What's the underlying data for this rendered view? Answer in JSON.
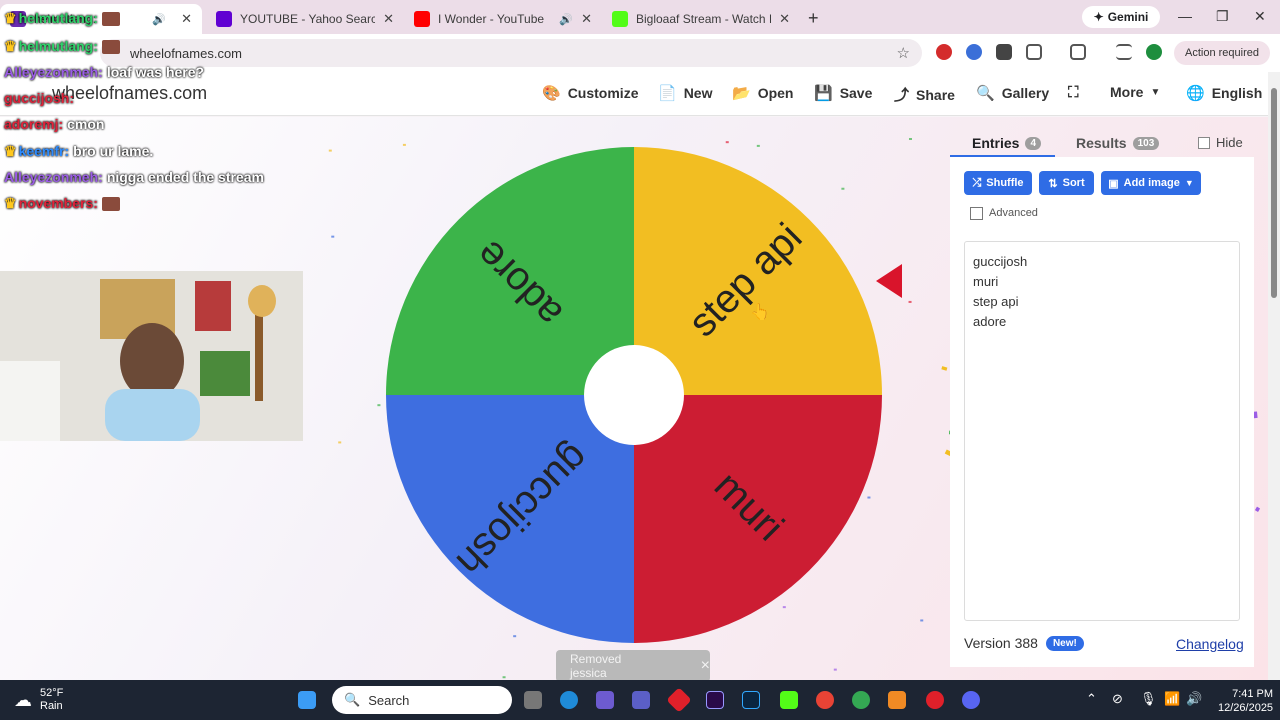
{
  "browser": {
    "tabs": [
      {
        "title": "helmutlang:",
        "favicon_color": "#6a2cb0",
        "audio": true
      },
      {
        "title": "YOUTUBE - Yahoo Search Results",
        "favicon_color": "#6001d2",
        "audio": false
      },
      {
        "title": "I Wonder - YouTube",
        "favicon_color": "#ff0000",
        "audio": true
      },
      {
        "title": "Bigloaaf Stream - Watch Live on",
        "favicon_color": "#53fc18",
        "audio": false
      }
    ],
    "new_tab_symbol": "+",
    "gemini_label": "Gemini",
    "url": "wheelofnames.com",
    "action_required": "Action required"
  },
  "site": {
    "logo_text": "wheelofnames.com",
    "nav": [
      {
        "label": "Customize",
        "icon": "palette-icon"
      },
      {
        "label": "New",
        "icon": "file-icon"
      },
      {
        "label": "Open",
        "icon": "folder-icon"
      },
      {
        "label": "Save",
        "icon": "save-icon"
      },
      {
        "label": "Share",
        "icon": "share-icon"
      },
      {
        "label": "Gallery",
        "icon": "search-icon"
      },
      {
        "label": "",
        "icon": "fullscreen-icon"
      },
      {
        "label": "More",
        "icon": "chevron-down-icon"
      },
      {
        "label": "English",
        "icon": "globe-icon"
      }
    ]
  },
  "wheel": {
    "segments": [
      {
        "label": "step api",
        "color": "#f2be22"
      },
      {
        "label": "muri",
        "color": "#cc1d33"
      },
      {
        "label": "guccijosh",
        "color": "#3e6ee0"
      },
      {
        "label": "adore",
        "color": "#3cb44a"
      }
    ],
    "pointer_color": "#d9142b"
  },
  "panel": {
    "tabs": [
      {
        "label": "Entries",
        "count": "4"
      },
      {
        "label": "Results",
        "count": "103"
      }
    ],
    "hide_label": "Hide",
    "buttons": {
      "shuffle": "Shuffle",
      "sort": "Sort",
      "add_image": "Add image"
    },
    "advanced_label": "Advanced",
    "entries": [
      "guccijosh",
      "muri",
      "step api",
      "adore"
    ],
    "version": "Version 388",
    "new_badge": "New!",
    "changelog": "Changelog"
  },
  "toast": {
    "text": "Removed jessica",
    "close": "×"
  },
  "stream_chat": [
    {
      "user": "helmutlang:",
      "user_color": "#2fd36b",
      "message": "",
      "crown": true,
      "emote": true
    },
    {
      "user": "helmutlang:",
      "user_color": "#2fd36b",
      "message": "",
      "crown": true,
      "emote": true
    },
    {
      "user": "Alleyezonmeh:",
      "user_color": "#9b5de5",
      "message": "loaf was here?",
      "crown": false,
      "emote": false
    },
    {
      "user": "guccijosh:",
      "user_color": "#e0233a",
      "message": "",
      "crown": false,
      "emote": false
    },
    {
      "user": "adoremj:",
      "user_color": "#e0233a",
      "message": "cmon",
      "crown": false,
      "emote": false
    },
    {
      "user": "keemfr:",
      "user_color": "#2e8cff",
      "message": "bro ur lame.",
      "crown": true,
      "emote": false
    },
    {
      "user": "Alleyezonmeh:",
      "user_color": "#9b5de5",
      "message": "nigga ended the stream",
      "crown": false,
      "emote": false
    },
    {
      "user": "novembers:",
      "user_color": "#e0233a",
      "message": "",
      "crown": true,
      "emote": true
    }
  ],
  "taskbar": {
    "weather_temp": "52°F",
    "weather_desc": "Rain",
    "search_placeholder": "Search",
    "time": "7:41 PM",
    "date": "12/26/2025"
  }
}
